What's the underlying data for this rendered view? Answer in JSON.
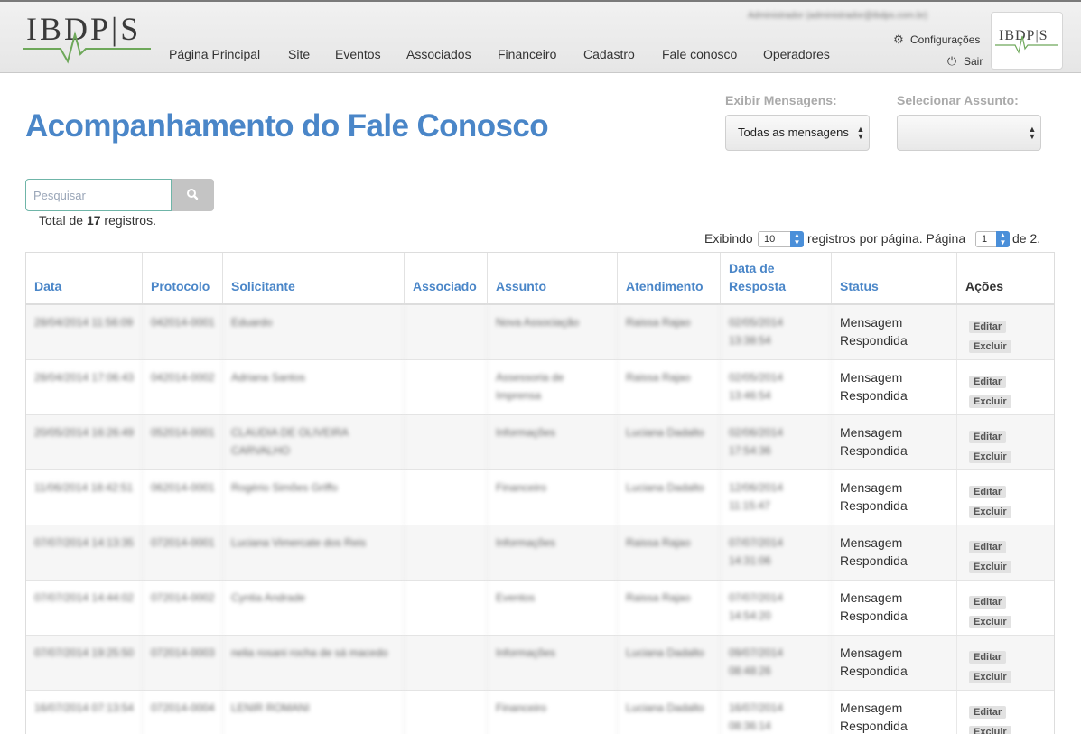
{
  "header": {
    "logo_text": "IBDP|S",
    "user_email": "Administrador (administrador@ibdps.com.br)",
    "settings_label": "Configurações",
    "logout_label": "Sair",
    "nav": [
      "Página Principal",
      "Site",
      "Eventos",
      "Associados",
      "Financeiro",
      "Cadastro",
      "Fale conosco",
      "Operadores"
    ]
  },
  "page": {
    "title": "Acompanhamento do Fale Conosco"
  },
  "filters": {
    "messages_label": "Exibir Mensagens:",
    "messages_value": "Todas as mensagens",
    "subject_label": "Selecionar Assunto:",
    "subject_value": ""
  },
  "search": {
    "placeholder": "Pesquisar"
  },
  "summary": {
    "total_prefix": "Total de ",
    "total_count": "17",
    "total_suffix": " registros."
  },
  "pagination": {
    "showing_label": "Exibindo",
    "per_page": "10",
    "per_page_suffix": "registros por página. Página",
    "current_page": "1",
    "of_label": "de 2."
  },
  "table": {
    "columns": [
      "Data",
      "Protocolo",
      "Solicitante",
      "Associado",
      "Assunto",
      "Atendimento",
      "Data de Resposta",
      "Status",
      "Ações"
    ],
    "edit_label": "Editar",
    "delete_label": "Excluir",
    "rows": [
      {
        "data": "28/04/2014 11:56:09",
        "protocolo": "042014-0001",
        "solicitante": "Eduardo",
        "associado": "",
        "assunto": "Nova Associação",
        "atendimento": "Raissa Rajao",
        "resposta": "02/05/2014 13:38:54",
        "status": "Mensagem Respondida"
      },
      {
        "data": "28/04/2014 17:06:43",
        "protocolo": "042014-0002",
        "solicitante": "Adriana Santos",
        "associado": "",
        "assunto": "Assessoria de Imprensa",
        "atendimento": "Raissa Rajao",
        "resposta": "02/05/2014 13:46:54",
        "status": "Mensagem Respondida"
      },
      {
        "data": "20/05/2014 16:26:49",
        "protocolo": "052014-0001",
        "solicitante": "CLAUDIA DE OLIVEIRA CARVALHO",
        "associado": "",
        "assunto": "Informações",
        "atendimento": "Luciana Dadalto",
        "resposta": "02/06/2014 17:54:36",
        "status": "Mensagem Respondida"
      },
      {
        "data": "11/06/2014 18:42:51",
        "protocolo": "062014-0001",
        "solicitante": "Rogério Simões Griffo",
        "associado": "",
        "assunto": "Financeiro",
        "atendimento": "Luciana Dadalto",
        "resposta": "12/06/2014 11:15:47",
        "status": "Mensagem Respondida"
      },
      {
        "data": "07/07/2014 14:13:35",
        "protocolo": "072014-0001",
        "solicitante": "Luciana Vimercate dos Reis",
        "associado": "",
        "assunto": "Informações",
        "atendimento": "Raissa Rajao",
        "resposta": "07/07/2014 14:31:06",
        "status": "Mensagem Respondida"
      },
      {
        "data": "07/07/2014 14:44:02",
        "protocolo": "072014-0002",
        "solicitante": "Cyntia Andrade",
        "associado": "",
        "assunto": "Eventos",
        "atendimento": "Raissa Rajao",
        "resposta": "07/07/2014 14:54:20",
        "status": "Mensagem Respondida"
      },
      {
        "data": "07/07/2014 19:25:50",
        "protocolo": "072014-0003",
        "solicitante": "nelia rosani rocha de sá macedo",
        "associado": "",
        "assunto": "Informações",
        "atendimento": "Luciana Dadalto",
        "resposta": "09/07/2014 08:48:26",
        "status": "Mensagem Respondida"
      },
      {
        "data": "16/07/2014 07:13:54",
        "protocolo": "072014-0004",
        "solicitante": "LENIR ROMANI",
        "associado": "",
        "assunto": "Financeiro",
        "atendimento": "Luciana Dadalto",
        "resposta": "16/07/2014 08:36:14",
        "status": "Mensagem Respondida"
      }
    ]
  }
}
